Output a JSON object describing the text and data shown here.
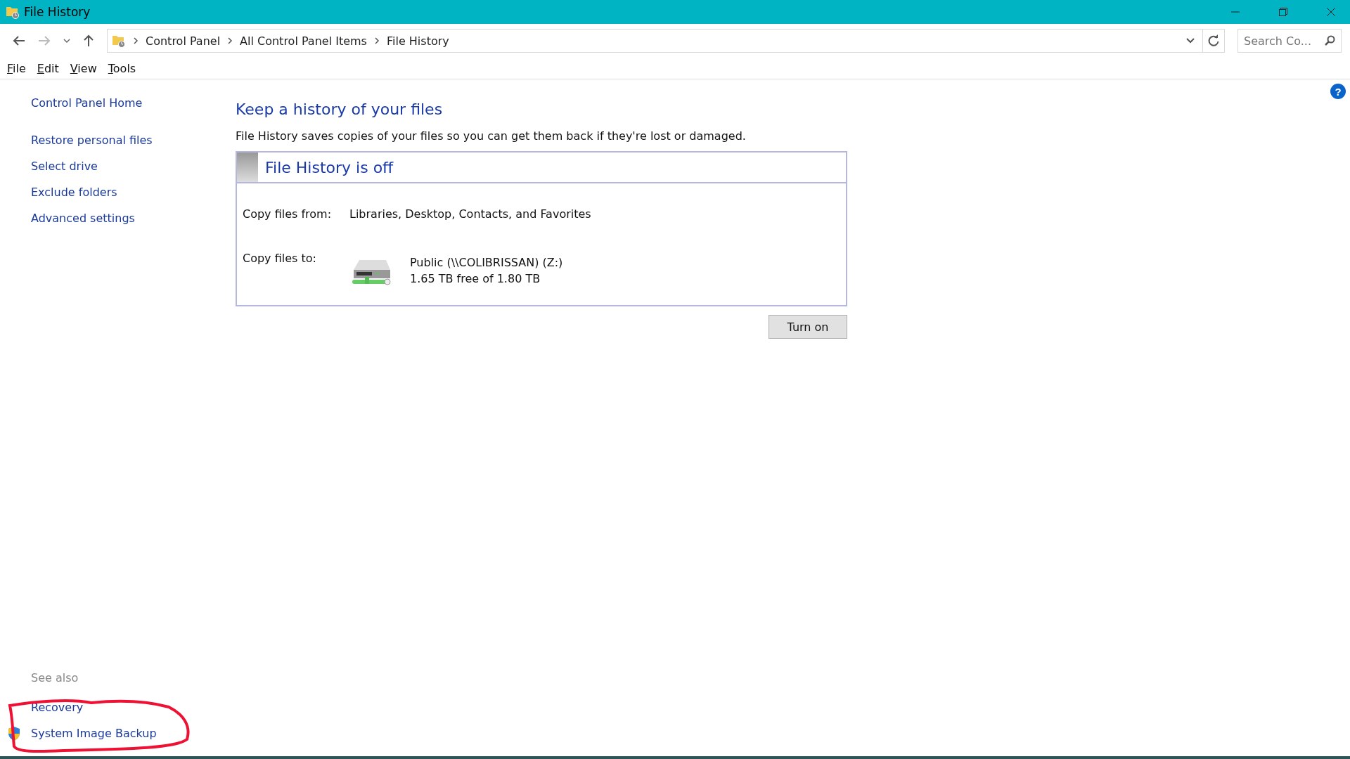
{
  "window": {
    "title": "File History"
  },
  "breadcrumb": [
    "Control Panel",
    "All Control Panel Items",
    "File History"
  ],
  "search": {
    "placeholder": "Search Co..."
  },
  "help": "?",
  "menu": [
    "File",
    "Edit",
    "View",
    "Tools"
  ],
  "sidebar": {
    "home": "Control Panel Home",
    "links": [
      "Restore personal files",
      "Select drive",
      "Exclude folders",
      "Advanced settings"
    ],
    "see_also": {
      "heading": "See also",
      "links": [
        {
          "label": "Recovery",
          "kind": "plain"
        },
        {
          "label": "System Image Backup",
          "kind": "shield"
        }
      ]
    }
  },
  "content": {
    "heading": "Keep a history of your files",
    "description": "File History saves copies of your files so you can get them back if they're lost or damaged.",
    "status": {
      "title": "File History is off",
      "on": false
    },
    "copy_from": {
      "label": "Copy files from:",
      "value": "Libraries, Desktop, Contacts, and Favorites"
    },
    "copy_to": {
      "label": "Copy files to:",
      "drive": "Public (\\\\COLIBRISSAN) (Z:)",
      "space": "1.65 TB free of 1.80 TB"
    },
    "button": "Turn on"
  }
}
